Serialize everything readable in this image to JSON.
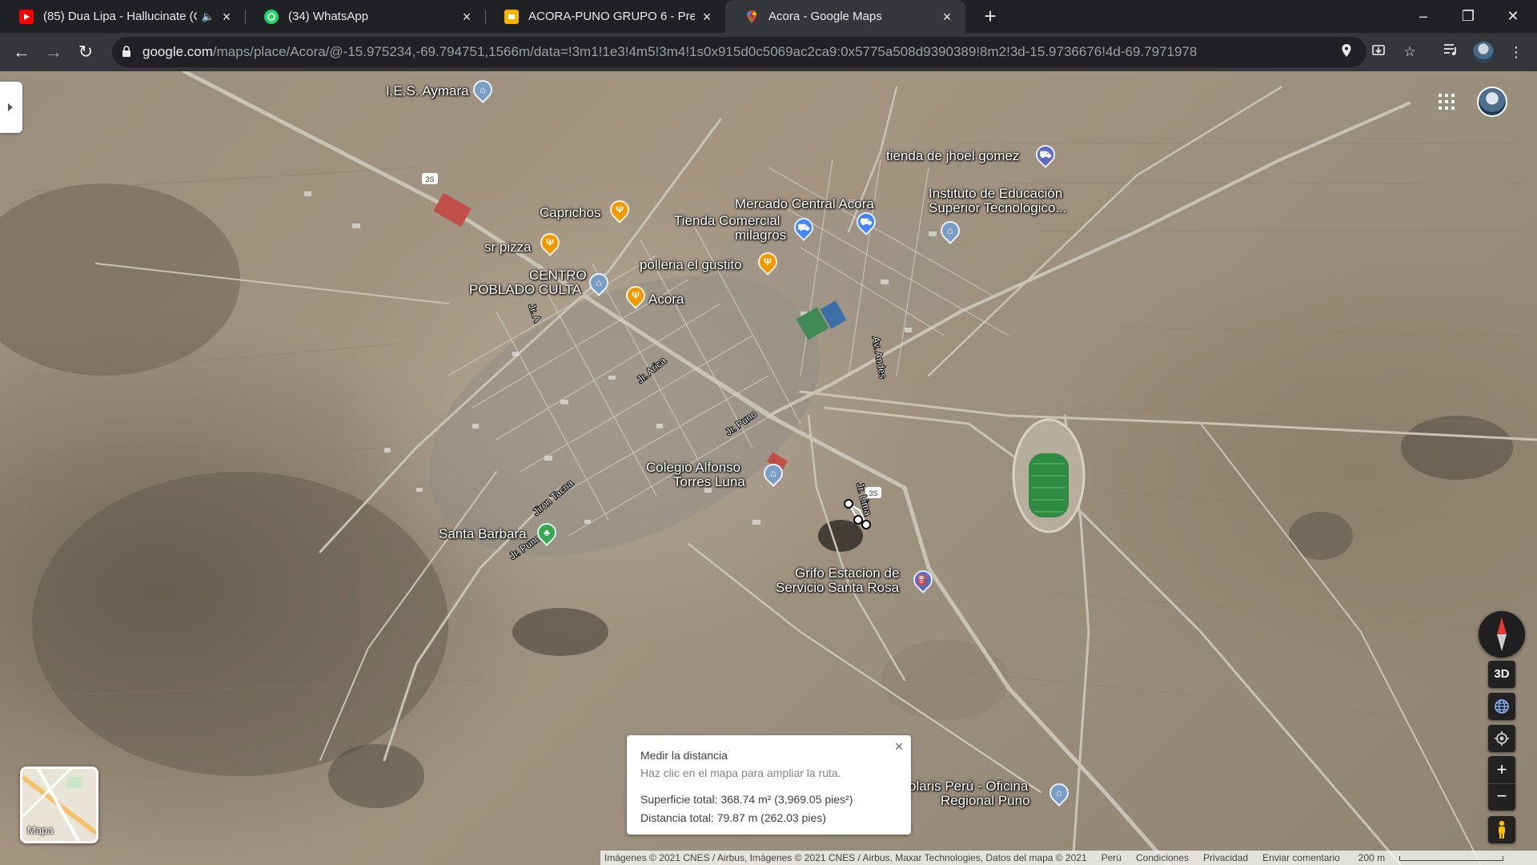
{
  "tabs": [
    {
      "title": "(85) Dua Lipa - Hallucinate (C",
      "favicon": "youtube-icon",
      "color": "#ff0000"
    },
    {
      "title": "(34) WhatsApp",
      "favicon": "whatsapp-icon",
      "color": "#25d366"
    },
    {
      "title": "ACORA-PUNO GRUPO 6 - Presen",
      "favicon": "slides-icon",
      "color": "#f4b400"
    },
    {
      "title": "Acora - Google Maps",
      "favicon": "maps-icon",
      "color": "#4285f4",
      "active": true
    }
  ],
  "toolbar": {
    "url_host": "google.com",
    "url_path": "/maps/place/Acora/@-15.975234,-69.794751,1566m/data=!3m1!1e3!4m5!3m4!1s0x915d0c5069ac2ca9:0x5775a508d9390389!8m2!3d-15.9736676!4d-69.7971978"
  },
  "map": {
    "pois": [
      {
        "label": "I.E.S. Aymara",
        "type": "school",
        "color": "#7b9ec4"
      },
      {
        "label": "Caprichos",
        "type": "restaurant",
        "color": "#f29900"
      },
      {
        "label": "sr pizza",
        "type": "restaurant",
        "color": "#f29900"
      },
      {
        "label": "CENTRO POBLADO CULTA",
        "line1": "CENTRO",
        "line2": "POBLADO CULTA",
        "type": "civic",
        "color": "#7b9ec4"
      },
      {
        "label": "Acora",
        "type": "restaurant",
        "color": "#f29900"
      },
      {
        "label": "polleria el gustito",
        "type": "restaurant",
        "color": "#f29900"
      },
      {
        "label": "Tienda Comercial milagros",
        "line1": "Tienda Comercial",
        "line2": "milagros",
        "type": "shopping",
        "color": "#4285f4"
      },
      {
        "label": "Mercado Central Acora",
        "type": "shopping",
        "color": "#4285f4"
      },
      {
        "label": "tienda de jhoel gomez",
        "type": "shopping",
        "color": "#5c6bc0"
      },
      {
        "label": "Instituto de Educación Superior Tecnológico...",
        "line1": "Instituto de Educación",
        "line2": "Superior Tecnológico...",
        "type": "school",
        "color": "#7b9ec4"
      },
      {
        "label": "Colegio Alfonso Torres Luna",
        "line1": "Colegio Alfonso",
        "line2": "Torres Luna",
        "type": "school",
        "color": "#7b9ec4"
      },
      {
        "label": "Santa Barbara",
        "type": "park",
        "color": "#34a853"
      },
      {
        "label": "Grifo Estacion de Servicio Santa Rosa",
        "line1": "Grifo Estacion de",
        "line2": "Servicio Santa Rosa",
        "type": "gas",
        "color": "#5c6bc0"
      },
      {
        "label": "olaris Perú - Oficina Regional Puno",
        "line1": "olaris Perú - Oficina",
        "line2": "Regional Puno",
        "type": "civic",
        "color": "#7b9ec4"
      }
    ],
    "streets": [
      "Jr. Puno",
      "Jr. Puno",
      "Jiron Tacna",
      "Jr. Arica",
      "Jr. A",
      "Jr. Lima",
      "Av. Andes"
    ],
    "route_shield": "3S",
    "layer_button_label": "Mapa",
    "controls": {
      "tilt_label": "3D",
      "zoom_in": "+",
      "zoom_out": "−"
    }
  },
  "measure": {
    "title": "Medir la distancia",
    "hint": "Haz clic en el mapa para ampliar la ruta.",
    "area": "Superficie total: 368.74 m² (3,969.05 pies²)",
    "distance": "Distancia total: 79.87 m (262.03 pies)"
  },
  "footer": {
    "imagery": "Imágenes © 2021 CNES / Airbus, Imágenes © 2021 CNES / Airbus, Maxar Technologies, Datos del mapa © 2021",
    "country": "Perú",
    "terms": "Condiciones",
    "privacy": "Privacidad",
    "feedback": "Enviar comentario",
    "scale": "200 m"
  }
}
